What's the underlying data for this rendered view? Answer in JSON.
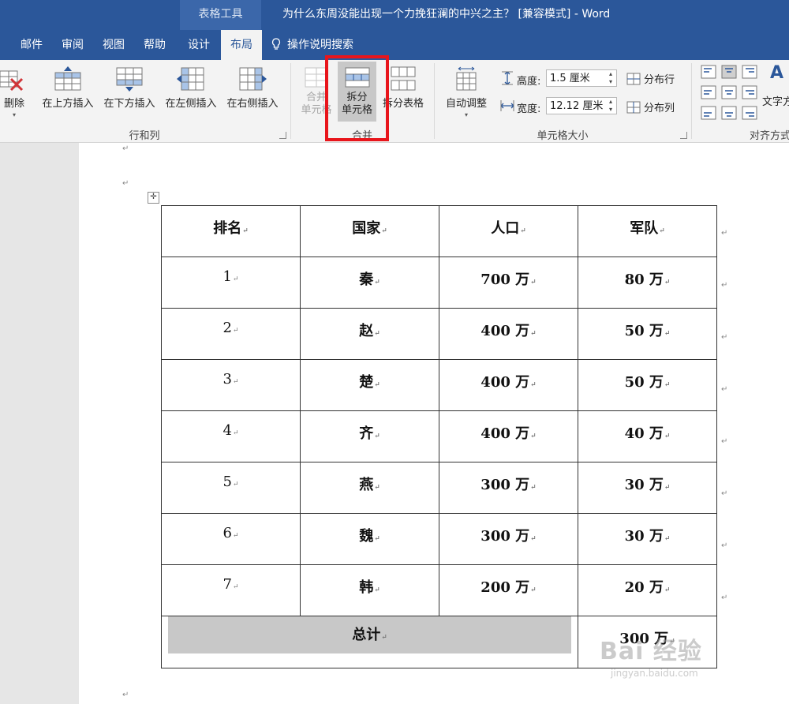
{
  "titlebar": {
    "context_tab": "表格工具",
    "document_title": "为什么东周没能出现一个力挽狂澜的中兴之主？ [兼容模式] - Word"
  },
  "tabs": [
    {
      "label": "邮件"
    },
    {
      "label": "审阅"
    },
    {
      "label": "视图"
    },
    {
      "label": "帮助"
    },
    {
      "label": "设计"
    },
    {
      "label": "布局",
      "active": true
    }
  ],
  "tell_me": "操作说明搜索",
  "ribbon": {
    "rows_cols": {
      "delete": "删除",
      "insert_above": "在上方插入",
      "insert_below": "在下方插入",
      "insert_left": "在左侧插入",
      "insert_right": "在右侧插入",
      "group_label": "行和列"
    },
    "merge": {
      "merge_cells_line1": "合并",
      "merge_cells_line2": "单元格",
      "split_cells_line1": "拆分",
      "split_cells_line2": "单元格",
      "split_table": "拆分表格",
      "group_label": "合并"
    },
    "cell_size": {
      "autofit": "自动调整",
      "height_label": "高度:",
      "height_value": "1.5 厘米",
      "width_label": "宽度:",
      "width_value": "12.12 厘米",
      "distribute_rows": "分布行",
      "distribute_cols": "分布列",
      "group_label": "单元格大小"
    },
    "alignment": {
      "text_direction": "文字方",
      "group_label": "对齐方式"
    }
  },
  "table": {
    "headers": [
      "排名",
      "国家",
      "人口",
      "军队"
    ],
    "rows": [
      [
        "1",
        "秦",
        "700 万",
        "80 万"
      ],
      [
        "2",
        "赵",
        "400 万",
        "50 万"
      ],
      [
        "3",
        "楚",
        "400 万",
        "50 万"
      ],
      [
        "4",
        "齐",
        "400 万",
        "40 万"
      ],
      [
        "5",
        "燕",
        "300 万",
        "30 万"
      ],
      [
        "6",
        "魏",
        "300 万",
        "30 万"
      ],
      [
        "7",
        "韩",
        "200 万",
        "20 万"
      ]
    ],
    "total_label": "总计",
    "total_value": "300 万"
  },
  "watermark": {
    "line1": "Bai 经验",
    "line2": "jingyan.baidu.com"
  },
  "colors": {
    "word_blue": "#2b579a",
    "highlight_red": "#e8151b",
    "cell_shading": "#c8c8c8"
  }
}
